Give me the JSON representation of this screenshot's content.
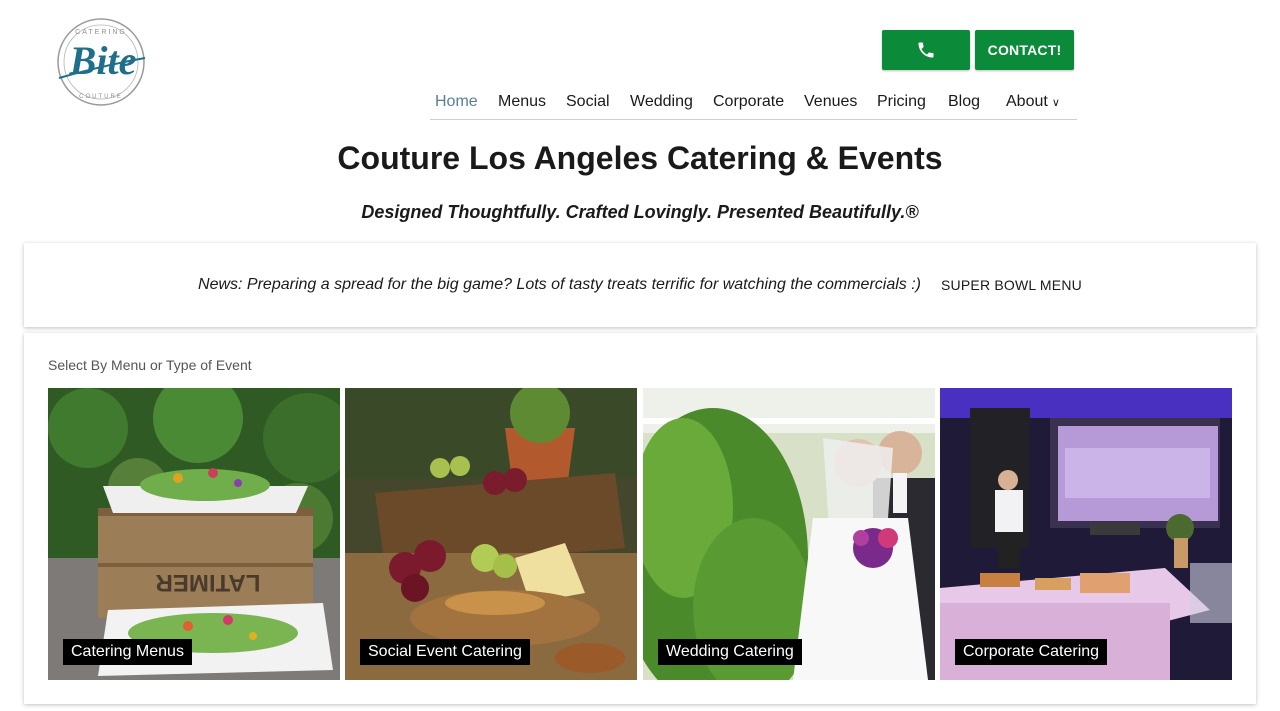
{
  "logo": {
    "text": "Bite",
    "ring_top": "CATERING",
    "ring_bottom": "COUTURE",
    "color": "#1f6f8b"
  },
  "header": {
    "phone_icon": "phone-icon",
    "contact_label": "CONTACT!",
    "accent": "#0b8a3a"
  },
  "nav": {
    "items": [
      "Home",
      "Menus",
      "Social",
      "Wedding",
      "Corporate",
      "Venues",
      "Pricing",
      "Blog",
      "About"
    ],
    "active": "Home",
    "about_chevron": "∨"
  },
  "hero": {
    "title": "Couture Los Angeles Catering & Events",
    "tagline": "Designed Thoughtfully. Crafted Lovingly. Presented Beautifully.®"
  },
  "news": {
    "text": "News: Preparing a spread for the big game? Lots of tasty treats terrific for watching the commercials :)",
    "link_label": "SUPER BOWL MENU"
  },
  "events": {
    "label": "Select By Menu or Type of Event",
    "tiles": [
      {
        "caption": "Catering Menus"
      },
      {
        "caption": "Social Event Catering"
      },
      {
        "caption": "Wedding Catering"
      },
      {
        "caption": "Corporate Catering"
      }
    ]
  }
}
